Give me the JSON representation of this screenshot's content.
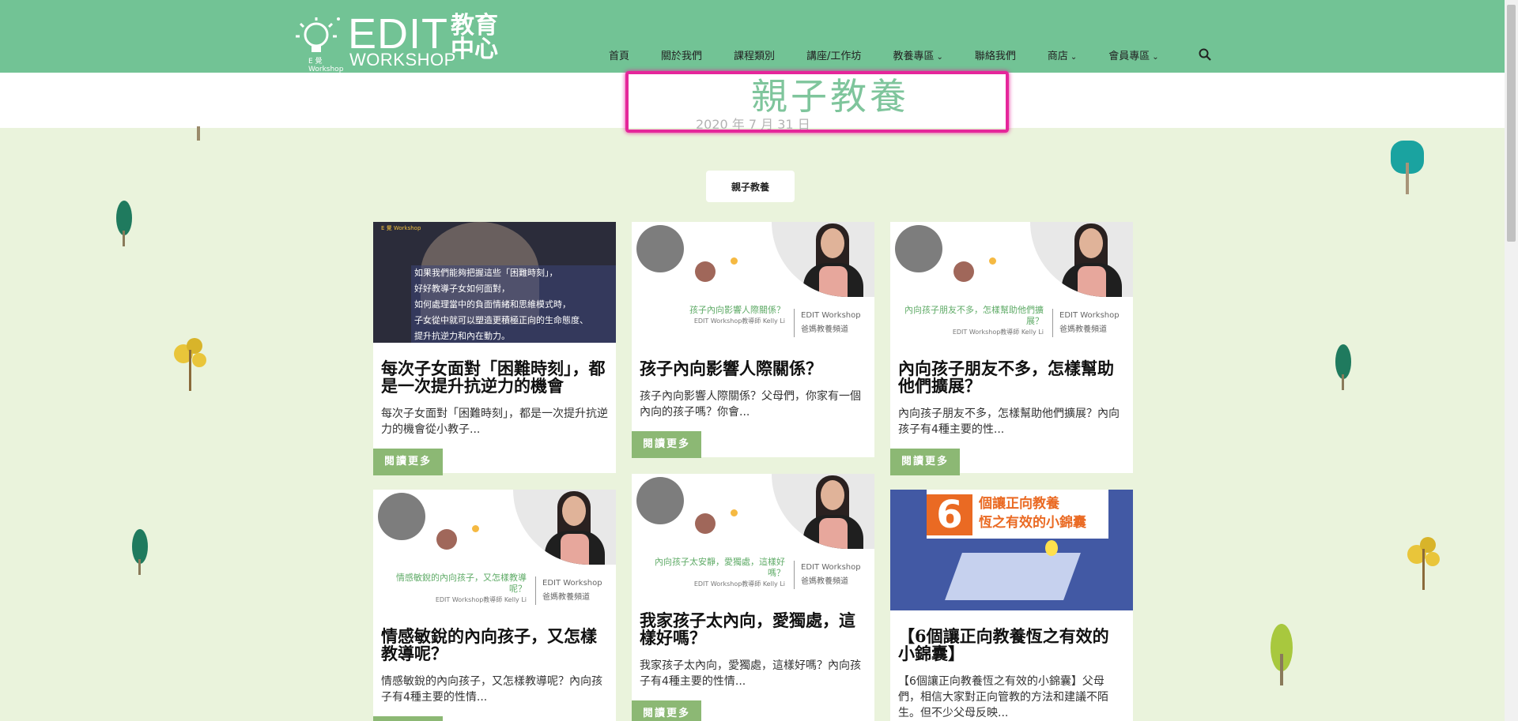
{
  "header": {
    "logo_main": "EDIT",
    "logo_sub": "WORKSHOP",
    "logo_cn": "教育中心",
    "logo_small": "E 覺 Workshop"
  },
  "nav": [
    {
      "label": "首頁",
      "dropdown": false
    },
    {
      "label": "關於我們",
      "dropdown": false
    },
    {
      "label": "課程類別",
      "dropdown": false
    },
    {
      "label": "講座/工作坊",
      "dropdown": false
    },
    {
      "label": "教養專區",
      "dropdown": true
    },
    {
      "label": "聯絡我們",
      "dropdown": false
    },
    {
      "label": "商店",
      "dropdown": true
    },
    {
      "label": "會員專區",
      "dropdown": true
    }
  ],
  "page": {
    "title": "親子教養",
    "date": "2020 年 7 月 31 日",
    "category_chip": "親子教養"
  },
  "read_more": "閱讀更多",
  "cards": [
    {
      "title": "每次子女面對「困難時刻」，都是一次提升抗逆力的機會",
      "excerpt": "每次子女面對「困難時刻」，都是一次提升抗逆力的機會從小教子...",
      "thumb_lines": [
        "如果我們能夠把握這些「困難時刻」，",
        "好好教導子女如何面對，",
        "如何處理當中的負面情緒和思維模式時，",
        "子女從中就可以塑造更積極正向的生命態度、",
        "提升抗逆力和內在動力。"
      ],
      "thumb_brand": "E 覺 Workshop"
    },
    {
      "title": "孩子內向影響人際關係？",
      "excerpt": "孩子內向影響人際關係？父母們，你家有一個內向的孩子嗎？你會...",
      "thumb_title": "孩子內向影響人際關係？",
      "thumb_caption": "EDIT Workshop教導師 Kelly Li",
      "thumb_brand": "EDIT Workshop",
      "thumb_brand2": "爸媽教養頻道"
    },
    {
      "title": "內向孩子朋友不多，怎樣幫助他們擴展？",
      "excerpt": "內向孩子朋友不多，怎樣幫助他們擴展？內向孩子有4種主要的性...",
      "thumb_title": "內向孩子朋友不多，怎樣幫助他們擴展？",
      "thumb_caption": "EDIT Workshop教導師 Kelly Li",
      "thumb_brand": "EDIT Workshop",
      "thumb_brand2": "爸媽教養頻道"
    },
    {
      "title": "情感敏銳的內向孩子，又怎樣教導呢？",
      "excerpt": "情感敏銳的內向孩子，又怎樣教導呢？內向孩子有4種主要的性情...",
      "thumb_title": "情感敏銳的內向孩子，又怎樣教導呢？",
      "thumb_caption": "EDIT Workshop教導師 Kelly Li",
      "thumb_brand": "EDIT Workshop",
      "thumb_brand2": "爸媽教養頻道"
    },
    {
      "title": "我家孩子太內向，愛獨處，這樣好嗎？",
      "excerpt": "我家孩子太內向，愛獨處，這樣好嗎？內向孩子有4種主要的性情...",
      "thumb_title": "內向孩子太安靜，愛獨處，這樣好嗎？",
      "thumb_caption": "EDIT Workshop教導師 Kelly Li",
      "thumb_brand": "EDIT Workshop",
      "thumb_brand2": "爸媽教養頻道"
    },
    {
      "title": "【6個讓正向教養恆之有效的小錦囊】",
      "excerpt": "【6個讓正向教養恆之有效的小錦囊】父母們，相信大家對正向管教的方法和建議不陌生。但不少父母反映...",
      "thumb_number": "6",
      "thumb_line1": "個讓正向教養",
      "thumb_line2": "恆之有效的小錦囊"
    }
  ],
  "colors": {
    "header_bg": "#72c395",
    "page_bg": "#eaf3dc",
    "title_color": "#7fc59c",
    "button_bg": "#8cb874",
    "highlight": "#e5269a"
  }
}
